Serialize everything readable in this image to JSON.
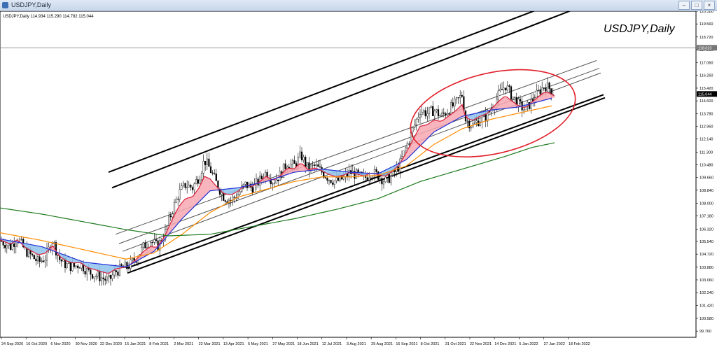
{
  "window": {
    "title": "USDJPY,Daily"
  },
  "header": {
    "info": "USDJPY,Daily  114.934 115.290 114.782 115.044"
  },
  "watermark": "USDJPY,Daily",
  "chart_data": {
    "type": "candlestick",
    "symbol": "USDJPY",
    "timeframe": "Daily",
    "ohlc_header": {
      "open": 114.934,
      "high": 115.29,
      "low": 114.782,
      "close": 115.044
    },
    "last_price": 115.044,
    "hline_price": 118.023,
    "ylim": [
      99.36,
      120.38
    ],
    "y_ticks": [
      120.38,
      119.56,
      118.72,
      117.9,
      117.06,
      116.26,
      115.42,
      114.6,
      113.78,
      112.96,
      112.14,
      111.3,
      110.48,
      109.66,
      108.84,
      108.0,
      107.18,
      106.32,
      105.54,
      104.72,
      103.88,
      103.06,
      102.24,
      101.42,
      100.58,
      99.76
    ],
    "x_labels": [
      "24 Sep 2020",
      "16 Oct 2020",
      "6 Nov 2020",
      "30 Nov 2020",
      "22 Dec 2020",
      "15 Jan 2021",
      "8 Feb 2021",
      "2 Mar 2021",
      "22 Mar 2021",
      "13 Apr 2021",
      "5 May 2021",
      "27 May 2021",
      "18 Jun 2021",
      "12 Jul 2021",
      "3 Aug 2021",
      "25 Aug 2021",
      "16 Sep 2021",
      "8 Oct 2021",
      "31 Oct 2021",
      "22 Nov 2021",
      "14 Dec 2021",
      "5 Jan 2022",
      "27 Jan 2022",
      "18 Feb 2022"
    ],
    "price_path": [
      [
        0,
        105.6
      ],
      [
        15,
        105.2
      ],
      [
        25,
        105.8
      ],
      [
        35,
        105.0
      ],
      [
        45,
        104.6
      ],
      [
        55,
        104.2
      ],
      [
        65,
        104.5
      ],
      [
        75,
        105.6
      ],
      [
        85,
        104.4
      ],
      [
        95,
        104.0
      ],
      [
        105,
        103.9
      ],
      [
        115,
        104.1
      ],
      [
        125,
        103.6
      ],
      [
        135,
        103.4
      ],
      [
        145,
        103.2
      ],
      [
        155,
        103.0
      ],
      [
        165,
        103.6
      ],
      [
        175,
        103.8
      ],
      [
        185,
        104.0
      ],
      [
        195,
        104.5
      ],
      [
        205,
        105.2
      ],
      [
        215,
        105.6
      ],
      [
        225,
        105.2
      ],
      [
        235,
        106.0
      ],
      [
        245,
        107.4
      ],
      [
        255,
        108.6
      ],
      [
        265,
        109.2
      ],
      [
        275,
        109.0
      ],
      [
        285,
        109.8
      ],
      [
        292,
        110.8
      ],
      [
        300,
        110.2
      ],
      [
        310,
        109.2
      ],
      [
        320,
        108.4
      ],
      [
        330,
        108.2
      ],
      [
        340,
        108.6
      ],
      [
        350,
        109.2
      ],
      [
        360,
        109.0
      ],
      [
        370,
        109.4
      ],
      [
        380,
        110.0
      ],
      [
        390,
        109.4
      ],
      [
        400,
        109.8
      ],
      [
        410,
        110.6
      ],
      [
        420,
        110.4
      ],
      [
        430,
        111.1
      ],
      [
        440,
        110.2
      ],
      [
        450,
        110.4
      ],
      [
        460,
        110.0
      ],
      [
        470,
        109.6
      ],
      [
        480,
        109.4
      ],
      [
        490,
        109.6
      ],
      [
        500,
        110.0
      ],
      [
        510,
        109.8
      ],
      [
        520,
        109.6
      ],
      [
        530,
        110.0
      ],
      [
        540,
        109.8
      ],
      [
        550,
        109.4
      ],
      [
        560,
        109.8
      ],
      [
        570,
        110.4
      ],
      [
        580,
        111.6
      ],
      [
        590,
        112.8
      ],
      [
        600,
        114.0
      ],
      [
        610,
        113.8
      ],
      [
        620,
        114.0
      ],
      [
        630,
        113.6
      ],
      [
        640,
        114.0
      ],
      [
        650,
        114.4
      ],
      [
        660,
        115.0
      ],
      [
        665,
        113.4
      ],
      [
        675,
        113.0
      ],
      [
        685,
        113.4
      ],
      [
        695,
        113.6
      ],
      [
        705,
        114.4
      ],
      [
        715,
        115.2
      ],
      [
        722,
        115.6
      ],
      [
        730,
        115.0
      ],
      [
        740,
        114.4
      ],
      [
        750,
        114.0
      ],
      [
        760,
        114.6
      ],
      [
        770,
        115.2
      ],
      [
        778,
        115.6
      ],
      [
        785,
        115.4
      ],
      [
        792,
        115.0
      ]
    ],
    "ma_series": [
      {
        "color": "#1f2fd6",
        "points": [
          [
            0,
            105.7
          ],
          [
            60,
            105.2
          ],
          [
            120,
            104.2
          ],
          [
            180,
            103.9
          ],
          [
            220,
            104.9
          ],
          [
            260,
            107.0
          ],
          [
            300,
            108.8
          ],
          [
            340,
            109.0
          ],
          [
            380,
            109.4
          ],
          [
            420,
            110.0
          ],
          [
            460,
            110.2
          ],
          [
            500,
            110.0
          ],
          [
            540,
            109.9
          ],
          [
            580,
            110.8
          ],
          [
            620,
            112.6
          ],
          [
            660,
            113.6
          ],
          [
            700,
            114.0
          ],
          [
            740,
            114.2
          ],
          [
            790,
            114.8
          ]
        ]
      },
      {
        "color": "#ff8c00",
        "points": [
          [
            0,
            106.1
          ],
          [
            60,
            105.6
          ],
          [
            120,
            105.0
          ],
          [
            180,
            104.4
          ],
          [
            220,
            104.8
          ],
          [
            260,
            106.0
          ],
          [
            300,
            107.4
          ],
          [
            340,
            108.4
          ],
          [
            380,
            108.9
          ],
          [
            420,
            109.4
          ],
          [
            460,
            109.7
          ],
          [
            500,
            109.7
          ],
          [
            540,
            109.8
          ],
          [
            580,
            110.4
          ],
          [
            620,
            111.8
          ],
          [
            660,
            112.8
          ],
          [
            700,
            113.4
          ],
          [
            740,
            113.8
          ],
          [
            790,
            114.3
          ]
        ]
      },
      {
        "color": "#1e7a1e",
        "points": [
          [
            0,
            107.7
          ],
          [
            60,
            107.3
          ],
          [
            120,
            106.8
          ],
          [
            180,
            106.3
          ],
          [
            240,
            105.9
          ],
          [
            300,
            106.0
          ],
          [
            360,
            106.5
          ],
          [
            420,
            107.0
          ],
          [
            480,
            107.6
          ],
          [
            540,
            108.3
          ],
          [
            600,
            109.4
          ],
          [
            660,
            110.2
          ],
          [
            720,
            111.0
          ],
          [
            760,
            111.6
          ],
          [
            792,
            111.9
          ]
        ]
      }
    ],
    "channel_lines": [
      {
        "x1": 155,
        "y1": 110.0,
        "x2": 833,
        "y2": 121.6,
        "width": 2
      },
      {
        "x1": 160,
        "y1": 109.0,
        "x2": 843,
        "y2": 120.9,
        "width": 2
      },
      {
        "x1": 180,
        "y1": 103.8,
        "x2": 862,
        "y2": 115.0,
        "width": 2
      },
      {
        "x1": 182,
        "y1": 103.5,
        "x2": 864,
        "y2": 114.8,
        "width": 2
      },
      {
        "x1": 165,
        "y1": 106.0,
        "x2": 852,
        "y2": 117.2,
        "width": 1
      },
      {
        "x1": 170,
        "y1": 105.4,
        "x2": 856,
        "y2": 116.7,
        "width": 1
      },
      {
        "x1": 175,
        "y1": 104.9,
        "x2": 858,
        "y2": 116.4,
        "width": 1
      }
    ],
    "ellipse": {
      "cx": 704,
      "cy": 113.8,
      "rx_days": 120,
      "ry_price": 2.6,
      "rotation_deg": -13,
      "color": "#e0202a"
    }
  }
}
